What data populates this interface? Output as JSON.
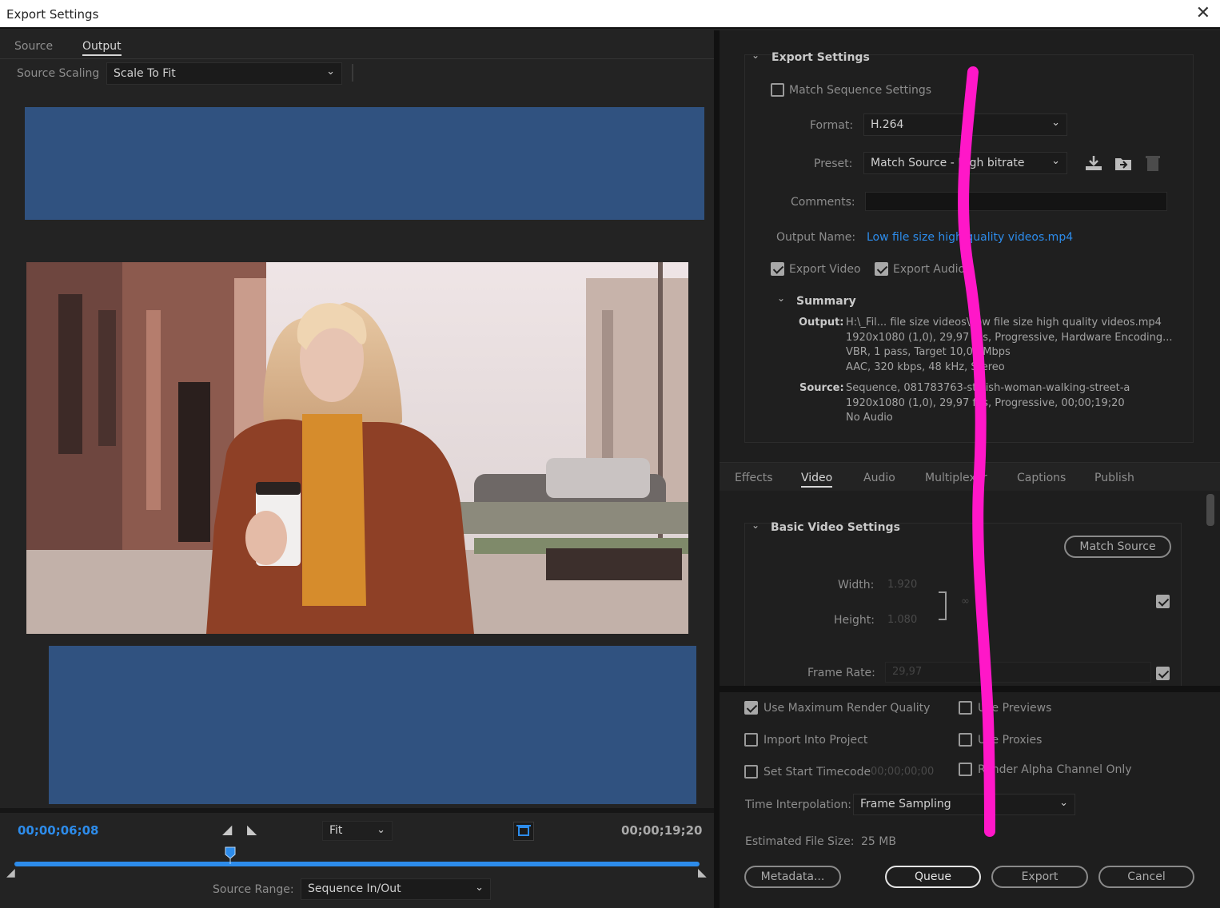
{
  "window": {
    "title": "Export Settings",
    "close": "✕"
  },
  "left": {
    "tabs": [
      "Source",
      "Output"
    ],
    "active_tab": "Output",
    "source_scaling": {
      "label": "Source Scaling",
      "value": "Scale To Fit"
    },
    "timeline": {
      "current_time": "00;00;06;08",
      "end_time": "00;00;19;20",
      "zoom": "Fit",
      "playhead_fraction": 0.315,
      "source_range": {
        "label": "Source Range:",
        "value": "Sequence In/Out"
      }
    }
  },
  "export_settings": {
    "heading": "Export Settings",
    "match_sequence": {
      "label": "Match Sequence Settings",
      "checked": false
    },
    "format": {
      "label": "Format:",
      "value": "H.264"
    },
    "preset": {
      "label": "Preset:",
      "value": "Match Source - High bitrate"
    },
    "comments": {
      "label": "Comments:",
      "value": ""
    },
    "output_name": {
      "label": "Output Name:",
      "value": "Low file size high quality videos.mp4"
    },
    "export_video": {
      "label": "Export Video",
      "checked": true
    },
    "export_audio": {
      "label": "Export Audio",
      "checked": true
    },
    "summary": {
      "heading": "Summary",
      "output_label": "Output:",
      "output_lines": [
        "H:\\_Fil... file size videos\\Low file size high quality videos.mp4",
        "1920x1080 (1,0), 29,97 fps, Progressive, Hardware Encoding...",
        "VBR, 1 pass, Target 10,00 Mbps",
        "AAC, 320 kbps, 48 kHz, Stereo"
      ],
      "source_label": "Source:",
      "source_lines": [
        "Sequence, 081783763-stylish-woman-walking-street-a",
        "1920x1080 (1,0), 29,97 fps, Progressive, 00;00;19;20",
        "No Audio"
      ]
    }
  },
  "settings_tabs": [
    "Effects",
    "Video",
    "Audio",
    "Multiplexer",
    "Captions",
    "Publish"
  ],
  "active_settings_tab": "Video",
  "basic_video": {
    "heading": "Basic Video Settings",
    "match_source_button": "Match Source",
    "width": {
      "label": "Width:",
      "value": "1.920"
    },
    "height": {
      "label": "Height:",
      "value": "1.080"
    },
    "frame_rate": {
      "label": "Frame Rate:",
      "value": "29,97"
    }
  },
  "options": {
    "use_max_render": {
      "label": "Use Maximum Render Quality",
      "checked": true
    },
    "use_previews": {
      "label": "Use Previews",
      "checked": false
    },
    "import_into_project": {
      "label": "Import Into Project",
      "checked": false
    },
    "use_proxies": {
      "label": "Use Proxies",
      "checked": false
    },
    "set_start_timecode": {
      "label": "Set Start Timecode",
      "value": "00;00;00;00",
      "checked": false
    },
    "render_alpha": {
      "label": "Render Alpha Channel Only",
      "checked": false
    },
    "time_interpolation": {
      "label": "Time Interpolation:",
      "value": "Frame Sampling"
    },
    "estimated_size": {
      "label": "Estimated File Size:",
      "value": "25 MB"
    }
  },
  "buttons": {
    "metadata": "Metadata...",
    "queue": "Queue",
    "export": "Export",
    "cancel": "Cancel"
  },
  "colors": {
    "letterbox": "#305280",
    "accent_blue": "#2d8ceb",
    "annotation": "#ff17c8"
  }
}
